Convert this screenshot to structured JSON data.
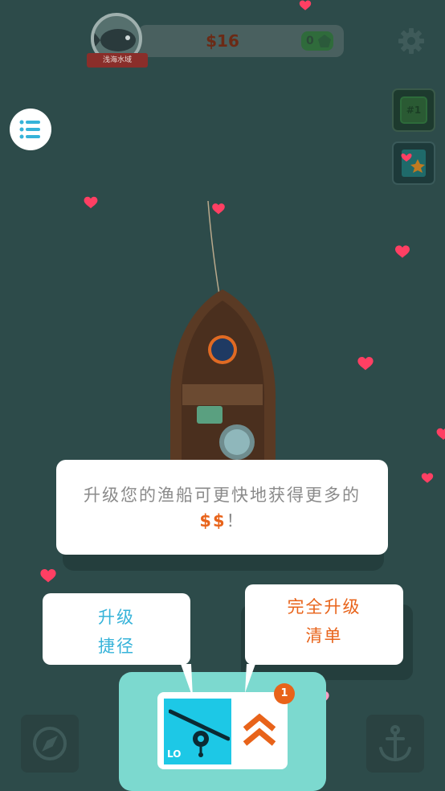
{
  "hud": {
    "money": "$16",
    "gems": "0",
    "zone_name": "浅海水域",
    "rank": "#1"
  },
  "tutorial": {
    "main_line1": "升级您的渔船可更快地获得更多的",
    "main_dollar": "$$",
    "main_exclaim": "！",
    "shortcut_line1": "升级",
    "shortcut_line2": "捷径",
    "full_line1": "完全升级",
    "full_line2": "清单"
  },
  "upgrade_card": {
    "rod_level": "LO",
    "notification_count": "1"
  },
  "colors": {
    "water": "#2d4b4a",
    "accent_orange": "#e8631a",
    "accent_blue": "#36b3d9",
    "panel_teal": "#7cd9cf",
    "heart": "#ff3f63"
  },
  "icons": [
    "menu-icon",
    "gear-icon",
    "rank-icon",
    "book-icon",
    "compass-icon",
    "anchor-icon",
    "fishing-rod-icon",
    "double-chevron-up-icon",
    "heart-icon",
    "fish-icon",
    "gem-icon"
  ]
}
